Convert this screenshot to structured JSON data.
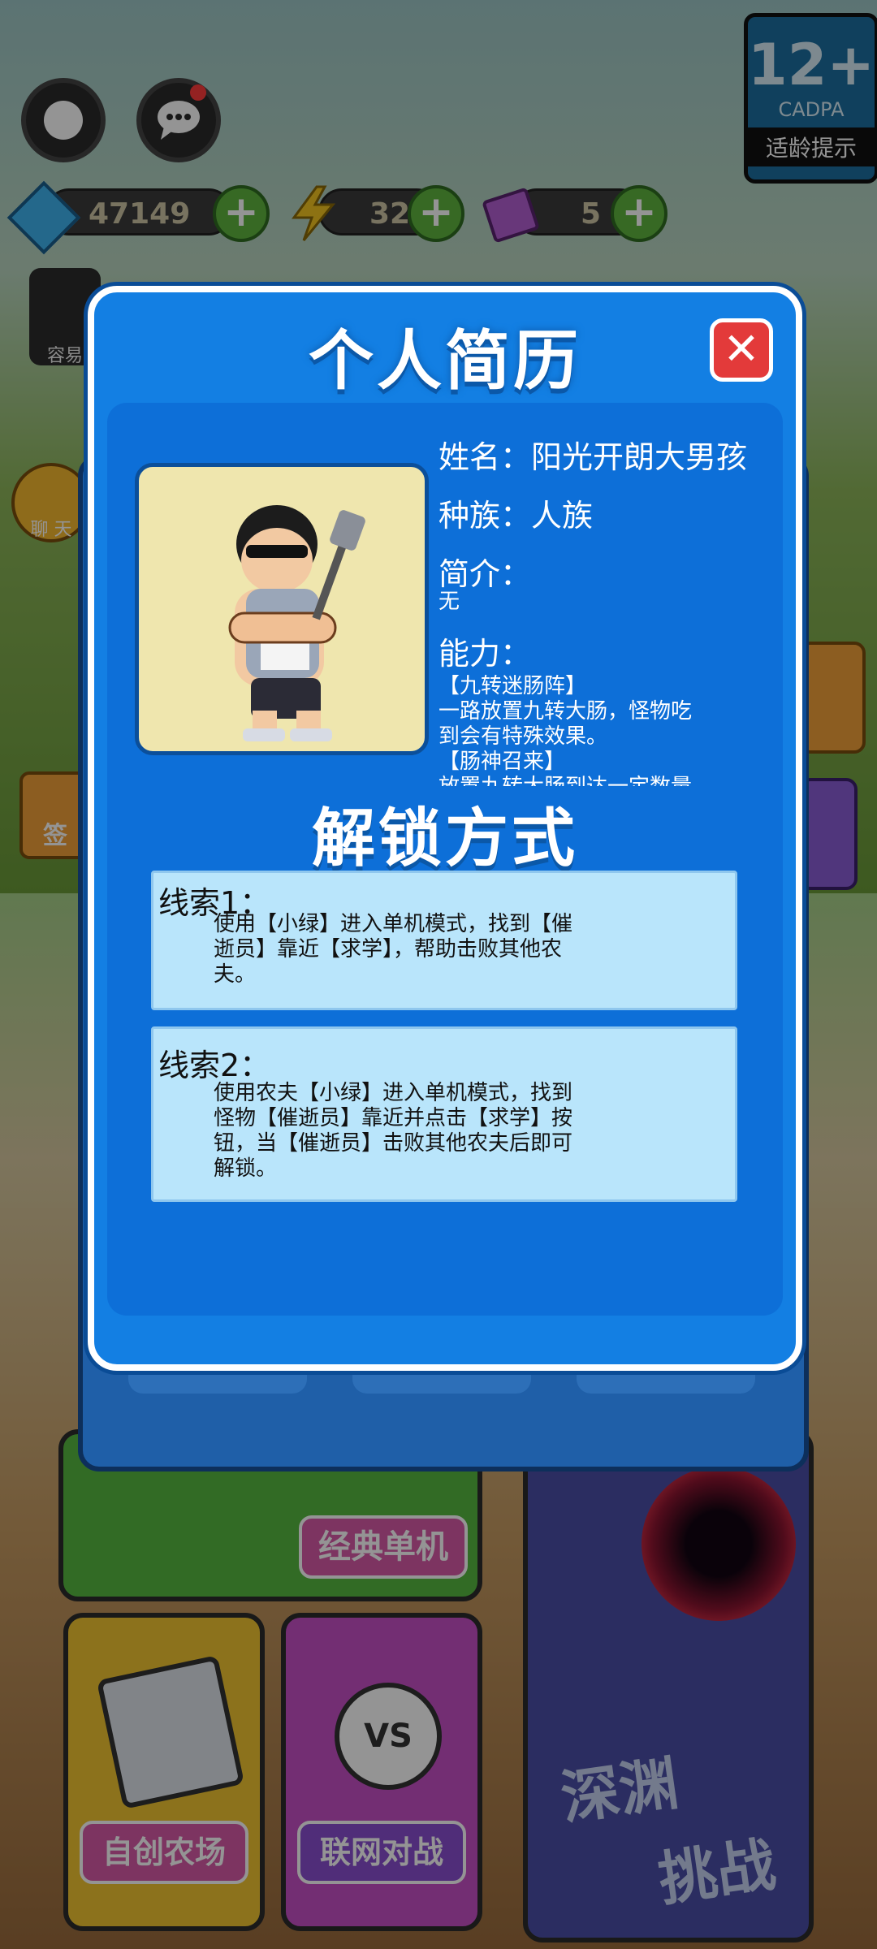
{
  "top": {
    "resources": [
      {
        "name": "diamond",
        "value": "47149",
        "color": "#3fb3f0"
      },
      {
        "name": "energy",
        "value": "32",
        "color": "#f3c521"
      },
      {
        "name": "ticket",
        "value": "5",
        "color": "#b45fd3"
      }
    ],
    "age_rating": {
      "number": "12+",
      "org": "CADPA",
      "label": "适龄提示"
    },
    "side_labels": {
      "chat": "聊 天",
      "friend": "容易",
      "sign": "签"
    }
  },
  "modes": {
    "classic": "经典单机",
    "abyss_line1": "深渊",
    "abyss_line2": "挑战",
    "create": "自创农场",
    "online": "联网对战",
    "vs": "VS"
  },
  "modal": {
    "title": "个人简历",
    "name_label": "姓名：阳光开朗大男孩",
    "race_label": "种族：人族",
    "intro_label": "简介：",
    "intro_value": "无",
    "ability_label": "能力：",
    "ability_lines": [
      "【九转迷肠阵】",
      "一路放置九转大肠，怪物吃",
      "到会有特殊效果。",
      "【肠神召来】",
      "放置九转大肠到达一定数量"
    ],
    "unlock_title": "解锁方式",
    "clues": [
      {
        "title": "线索1：",
        "lines": [
          "使用【小绿】进入单机模式，找到【催",
          "逝员】靠近【求学】，帮助击败其他农",
          "夫。"
        ]
      },
      {
        "title": "线索2：",
        "lines": [
          "使用农夫【小绿】进入单机模式，找到",
          "怪物【催逝员】靠近并点击【求学】按",
          "钮，当【催逝员】击败其他农夫后即可",
          "解锁。"
        ]
      }
    ]
  }
}
